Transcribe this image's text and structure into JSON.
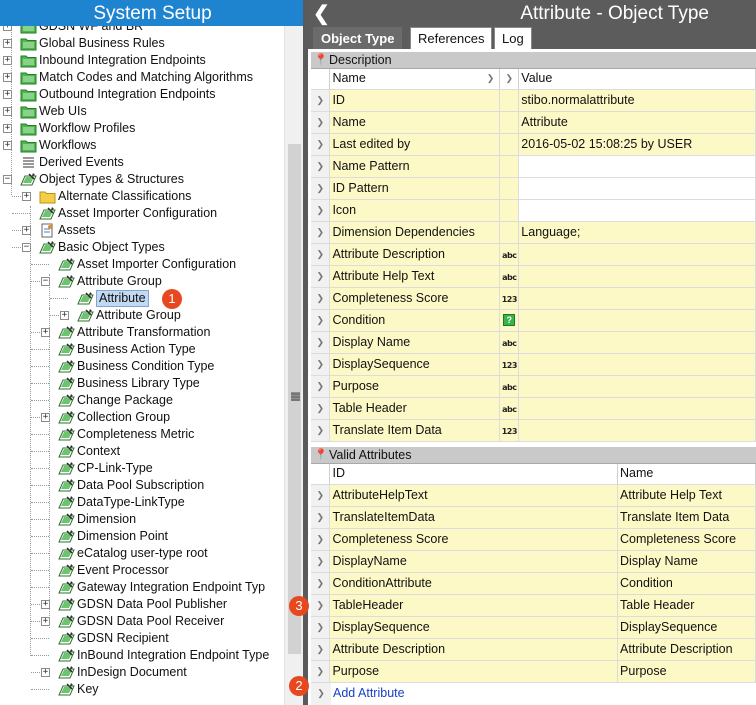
{
  "left_panel": {
    "title": "System Setup",
    "tree": [
      {
        "label": "GDSN WF and BR",
        "expander": "+",
        "icon": "green-folder-icon",
        "depth": 0
      },
      {
        "label": "Global Business Rules",
        "expander": "+",
        "icon": "green-folder-icon",
        "depth": 0
      },
      {
        "label": "Inbound Integration Endpoints",
        "expander": "+",
        "icon": "green-folder-icon",
        "depth": 0
      },
      {
        "label": "Match Codes and Matching Algorithms",
        "expander": "+",
        "icon": "green-folder-icon",
        "depth": 0
      },
      {
        "label": "Outbound Integration Endpoints",
        "expander": "+",
        "icon": "green-folder-icon",
        "depth": 0
      },
      {
        "label": "Web UIs",
        "expander": "+",
        "icon": "green-folder-icon",
        "depth": 0
      },
      {
        "label": "Workflow Profiles",
        "expander": "+",
        "icon": "green-folder-icon",
        "depth": 0
      },
      {
        "label": "Workflows",
        "expander": "+",
        "icon": "green-folder-icon",
        "depth": 0
      },
      {
        "label": "Derived Events",
        "expander": "",
        "icon": "list-icon",
        "depth": 0
      },
      {
        "label": "Object Types & Structures",
        "expander": "-",
        "icon": "object-type-icon",
        "depth": 0
      },
      {
        "label": "Alternate Classifications",
        "expander": "+",
        "icon": "yellow-folder-icon",
        "depth": 1
      },
      {
        "label": "Asset Importer Configuration",
        "expander": "",
        "icon": "object-type-icon",
        "depth": 1
      },
      {
        "label": "Assets",
        "expander": "+",
        "icon": "asset-icon",
        "depth": 1
      },
      {
        "label": "Basic Object Types",
        "expander": "-",
        "icon": "object-type-icon",
        "depth": 1
      },
      {
        "label": "Asset Importer Configuration",
        "expander": "",
        "icon": "object-type-icon",
        "depth": 2
      },
      {
        "label": "Attribute Group",
        "expander": "-",
        "icon": "object-type-icon",
        "depth": 2
      },
      {
        "label": "Attribute",
        "expander": "",
        "icon": "object-type-icon",
        "depth": 3,
        "selected": true
      },
      {
        "label": "Attribute Group",
        "expander": "+",
        "icon": "object-type-icon",
        "depth": 3
      },
      {
        "label": "Attribute Transformation",
        "expander": "+",
        "icon": "object-type-icon",
        "depth": 2
      },
      {
        "label": "Business Action Type",
        "expander": "",
        "icon": "object-type-icon",
        "depth": 2
      },
      {
        "label": "Business Condition Type",
        "expander": "",
        "icon": "object-type-icon",
        "depth": 2
      },
      {
        "label": "Business Library Type",
        "expander": "",
        "icon": "object-type-icon",
        "depth": 2
      },
      {
        "label": "Change Package",
        "expander": "",
        "icon": "object-type-icon",
        "depth": 2
      },
      {
        "label": "Collection Group",
        "expander": "+",
        "icon": "object-type-icon",
        "depth": 2
      },
      {
        "label": "Completeness Metric",
        "expander": "",
        "icon": "object-type-icon",
        "depth": 2
      },
      {
        "label": "Context",
        "expander": "",
        "icon": "object-type-icon",
        "depth": 2
      },
      {
        "label": "CP-Link-Type",
        "expander": "",
        "icon": "object-type-icon",
        "depth": 2
      },
      {
        "label": "Data Pool Subscription",
        "expander": "",
        "icon": "object-type-icon",
        "depth": 2
      },
      {
        "label": "DataType-LinkType",
        "expander": "",
        "icon": "object-type-icon",
        "depth": 2
      },
      {
        "label": "Dimension",
        "expander": "",
        "icon": "object-type-icon",
        "depth": 2
      },
      {
        "label": "Dimension Point",
        "expander": "",
        "icon": "object-type-icon",
        "depth": 2
      },
      {
        "label": "eCatalog user-type root",
        "expander": "",
        "icon": "object-type-icon",
        "depth": 2
      },
      {
        "label": "Event Processor",
        "expander": "",
        "icon": "object-type-icon",
        "depth": 2
      },
      {
        "label": "Gateway Integration Endpoint Typ",
        "expander": "",
        "icon": "object-type-icon",
        "depth": 2
      },
      {
        "label": "GDSN Data Pool Publisher",
        "expander": "+",
        "icon": "object-type-icon",
        "depth": 2
      },
      {
        "label": "GDSN Data Pool Receiver",
        "expander": "+",
        "icon": "object-type-icon",
        "depth": 2
      },
      {
        "label": "GDSN Recipient",
        "expander": "",
        "icon": "object-type-icon",
        "depth": 2
      },
      {
        "label": "InBound Integration Endpoint Type",
        "expander": "",
        "icon": "object-type-icon",
        "depth": 2
      },
      {
        "label": "InDesign Document",
        "expander": "+",
        "icon": "object-type-icon",
        "depth": 2
      },
      {
        "label": "Key",
        "expander": "",
        "icon": "object-type-icon",
        "depth": 2
      }
    ]
  },
  "right_panel": {
    "back_icon": "chevron-left-icon",
    "title": "Attribute - Object Type",
    "tabs": [
      {
        "label": "Object Type",
        "active": true
      },
      {
        "label": "References",
        "active": false
      },
      {
        "label": "Log",
        "active": false
      }
    ],
    "description": {
      "header": "Description",
      "col_name": "Name",
      "col_value": "Value",
      "rows": [
        {
          "name": "ID",
          "type": "",
          "value": "stibo.normalattribute"
        },
        {
          "name": "Name",
          "type": "",
          "value": "Attribute"
        },
        {
          "name": "Last edited by",
          "type": "",
          "value": "2016-05-02 15:08:25 by USER"
        },
        {
          "name": "Name Pattern",
          "type": "",
          "value": ""
        },
        {
          "name": "ID Pattern",
          "type": "",
          "value": ""
        },
        {
          "name": "Icon",
          "type": "",
          "value": ""
        },
        {
          "name": "Dimension Dependencies",
          "type": "",
          "value": "Language;"
        },
        {
          "name": "Attribute Description",
          "type": "abc",
          "value": ""
        },
        {
          "name": "Attribute Help Text",
          "type": "abc",
          "value": ""
        },
        {
          "name": "Completeness Score",
          "type": "123",
          "value": ""
        },
        {
          "name": "Condition",
          "type": "?",
          "value": ""
        },
        {
          "name": "Display Name",
          "type": "abc",
          "value": ""
        },
        {
          "name": "DisplaySequence",
          "type": "123",
          "value": ""
        },
        {
          "name": "Purpose",
          "type": "abc",
          "value": ""
        },
        {
          "name": "Table Header",
          "type": "abc",
          "value": ""
        },
        {
          "name": "Translate Item Data",
          "type": "123",
          "value": ""
        }
      ]
    },
    "valid_attributes": {
      "header": "Valid Attributes",
      "col_id": "ID",
      "col_name": "Name",
      "rows": [
        {
          "id": "AttributeHelpText",
          "name": "Attribute Help Text"
        },
        {
          "id": "TranslateItemData",
          "name": "Translate Item Data"
        },
        {
          "id": "Completeness Score",
          "name": "Completeness Score"
        },
        {
          "id": "DisplayName",
          "name": "Display Name"
        },
        {
          "id": "ConditionAttribute",
          "name": "Condition"
        },
        {
          "id": "TableHeader",
          "name": "Table Header"
        },
        {
          "id": "DisplaySequence",
          "name": "DisplaySequence"
        },
        {
          "id": "Attribute Description",
          "name": "Attribute Description"
        },
        {
          "id": "Purpose",
          "name": "Purpose"
        }
      ],
      "add_link": "Add Attribute"
    }
  },
  "badges": [
    "1",
    "2",
    "3"
  ],
  "colors": {
    "left_title_bg": "#1f84d0",
    "right_title_bg": "#5c5c5c",
    "cell_yellow": "#fdf9c7",
    "badge": "#e8481f",
    "link": "#1a3fc7"
  }
}
